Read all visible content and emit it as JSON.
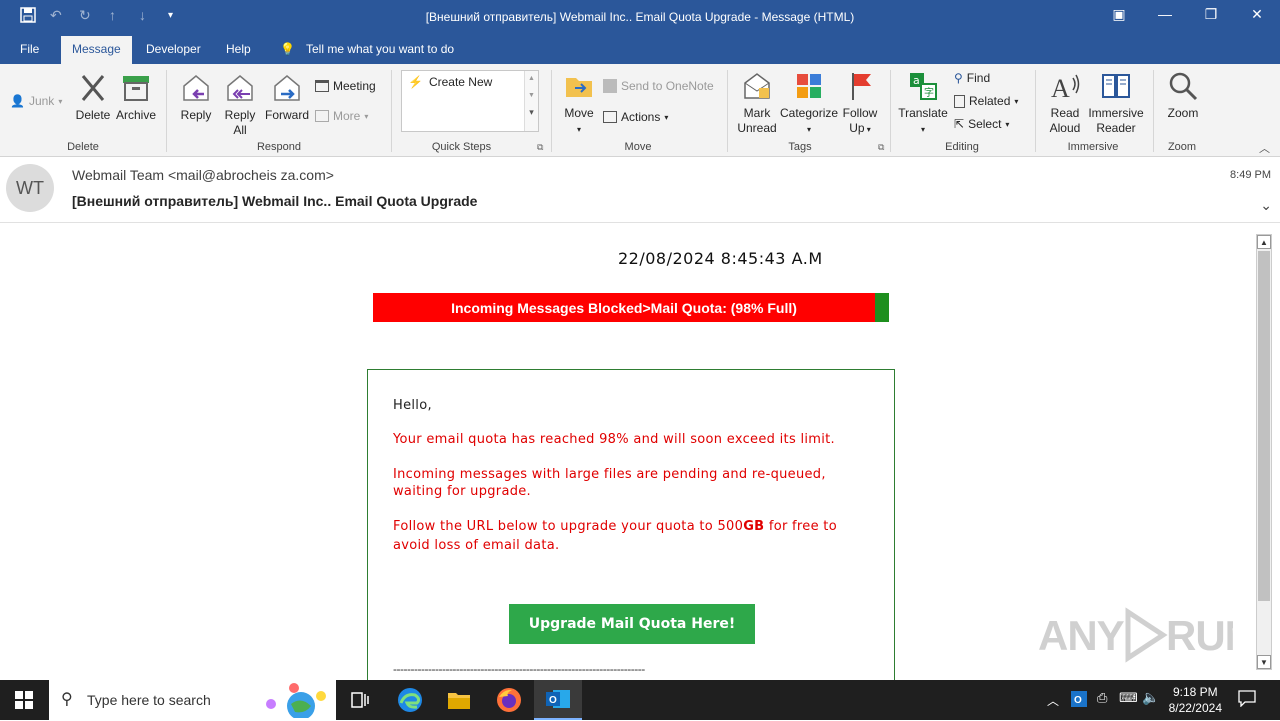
{
  "window": {
    "title": "[Внешний отправитель] Webmail Inc.. Email Quota Upgrade  -  Message (HTML)"
  },
  "tabs": {
    "file": "File",
    "message": "Message",
    "developer": "Developer",
    "help": "Help",
    "tell_me": "Tell me what you want to do"
  },
  "ribbon": {
    "junk": "Junk",
    "delete": "Delete",
    "archive": "Archive",
    "group_delete": "Delete",
    "reply": "Reply",
    "reply_all_1": "Reply",
    "reply_all_2": "All",
    "forward": "Forward",
    "meeting": "Meeting",
    "more": "More",
    "group_respond": "Respond",
    "create_new": "Create New",
    "group_quick_steps": "Quick Steps",
    "move": "Move",
    "send_onenote": "Send to OneNote",
    "actions": "Actions",
    "group_move": "Move",
    "mark_unread_1": "Mark",
    "mark_unread_2": "Unread",
    "categorize": "Categorize",
    "follow_up_1": "Follow",
    "follow_up_2": "Up",
    "group_tags": "Tags",
    "translate": "Translate",
    "find": "Find",
    "related": "Related",
    "select": "Select",
    "group_editing": "Editing",
    "read_aloud_1": "Read",
    "read_aloud_2": "Aloud",
    "immersive_1": "Immersive",
    "immersive_2": "Reader",
    "group_immersive": "Immersive",
    "zoom": "Zoom",
    "group_zoom": "Zoom"
  },
  "header": {
    "avatar_initials": "WT",
    "sender": "Webmail Team <mail@abrocheis za.com>",
    "subject": "[Внешний отправитель] Webmail Inc.. Email Quota Upgrade",
    "time": "8:49 PM"
  },
  "email": {
    "datetime": "22/08/2024 8:45:43 A.M",
    "quota_banner": "Incoming Messages Blocked>Mail Quota: (98% Full)",
    "quota_percent": 98,
    "greeting": "Hello,",
    "line1": "Your email quota has reached 98% and will soon exceed its limit.",
    "line2": "Incoming messages with large files are pending and re-queued, waiting for upgrade.",
    "line3_a": "Follow the URL below to upgrade your quota to 500",
    "line3_b": "GB",
    "line3_c": " for free to avoid loss of email data.",
    "cta": "Upgrade Mail Quota Here!",
    "divider": "------------------------------------------------------------------------"
  },
  "watermark": "ANY RUN",
  "taskbar": {
    "search_placeholder": "Type here to search",
    "time": "9:18 PM",
    "date": "8/22/2024"
  },
  "colors": {
    "titlebar": "#2b579a",
    "banner_red": "#ff0000",
    "banner_green": "#1e8f1e",
    "cta_green": "#2ea84a",
    "body_red": "#e00000"
  }
}
